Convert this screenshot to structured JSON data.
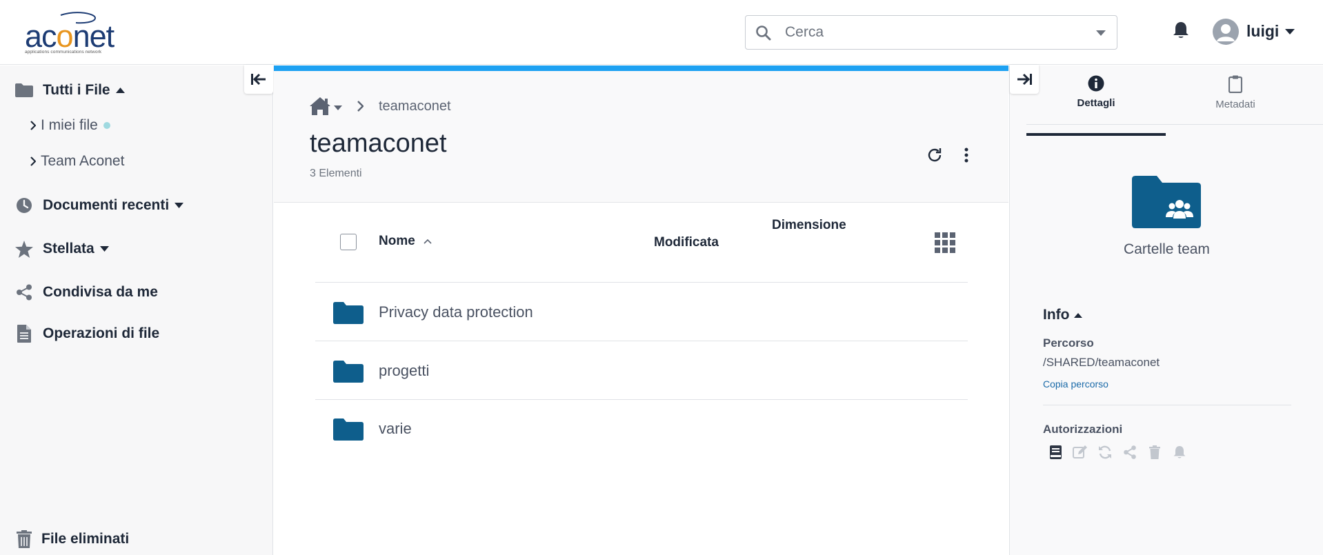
{
  "header": {
    "logo_text": "aconet",
    "logo_tagline": "applications communications network",
    "search_placeholder": "Cerca",
    "user_name": "luigi"
  },
  "sidebar": {
    "items": [
      {
        "label": "Tutti i File",
        "icon": "folder-icon"
      },
      {
        "label": "Documenti recenti",
        "icon": "clock-icon"
      },
      {
        "label": "Stellata",
        "icon": "star-icon"
      },
      {
        "label": "Condivisa da me",
        "icon": "share-icon"
      },
      {
        "label": "Operazioni di file",
        "icon": "file-text-icon"
      }
    ],
    "sub_items": [
      {
        "label": "I miei file"
      },
      {
        "label": "Team Aconet"
      }
    ],
    "trash_label": "File eliminati"
  },
  "main": {
    "breadcrumb": {
      "current": "teamaconet"
    },
    "title": "teamaconet",
    "count": "3 Elementi",
    "columns": {
      "name": "Nome",
      "modified": "Modificata",
      "size": "Dimensione"
    },
    "rows": [
      {
        "name": "Privacy data protection"
      },
      {
        "name": "progetti"
      },
      {
        "name": "varie"
      }
    ]
  },
  "details": {
    "tabs": [
      {
        "label": "Dettagli",
        "icon": "info-circle-icon"
      },
      {
        "label": "Metadati",
        "icon": "clipboard-icon"
      }
    ],
    "folder_type": "Cartelle team",
    "info_heading": "Info",
    "path_label": "Percorso",
    "path_value": "/SHARED/teamaconet",
    "copy_path": "Copia percorso",
    "permissions_label": "Autorizzazioni",
    "permissions": [
      "read-icon",
      "edit-icon",
      "sync-icon",
      "share-icon",
      "delete-icon",
      "notify-icon"
    ]
  },
  "colors": {
    "accent": "#1da1f2",
    "folder": "#0e5e8c",
    "text_dark": "#1e2838",
    "muted": "#6c737e"
  }
}
